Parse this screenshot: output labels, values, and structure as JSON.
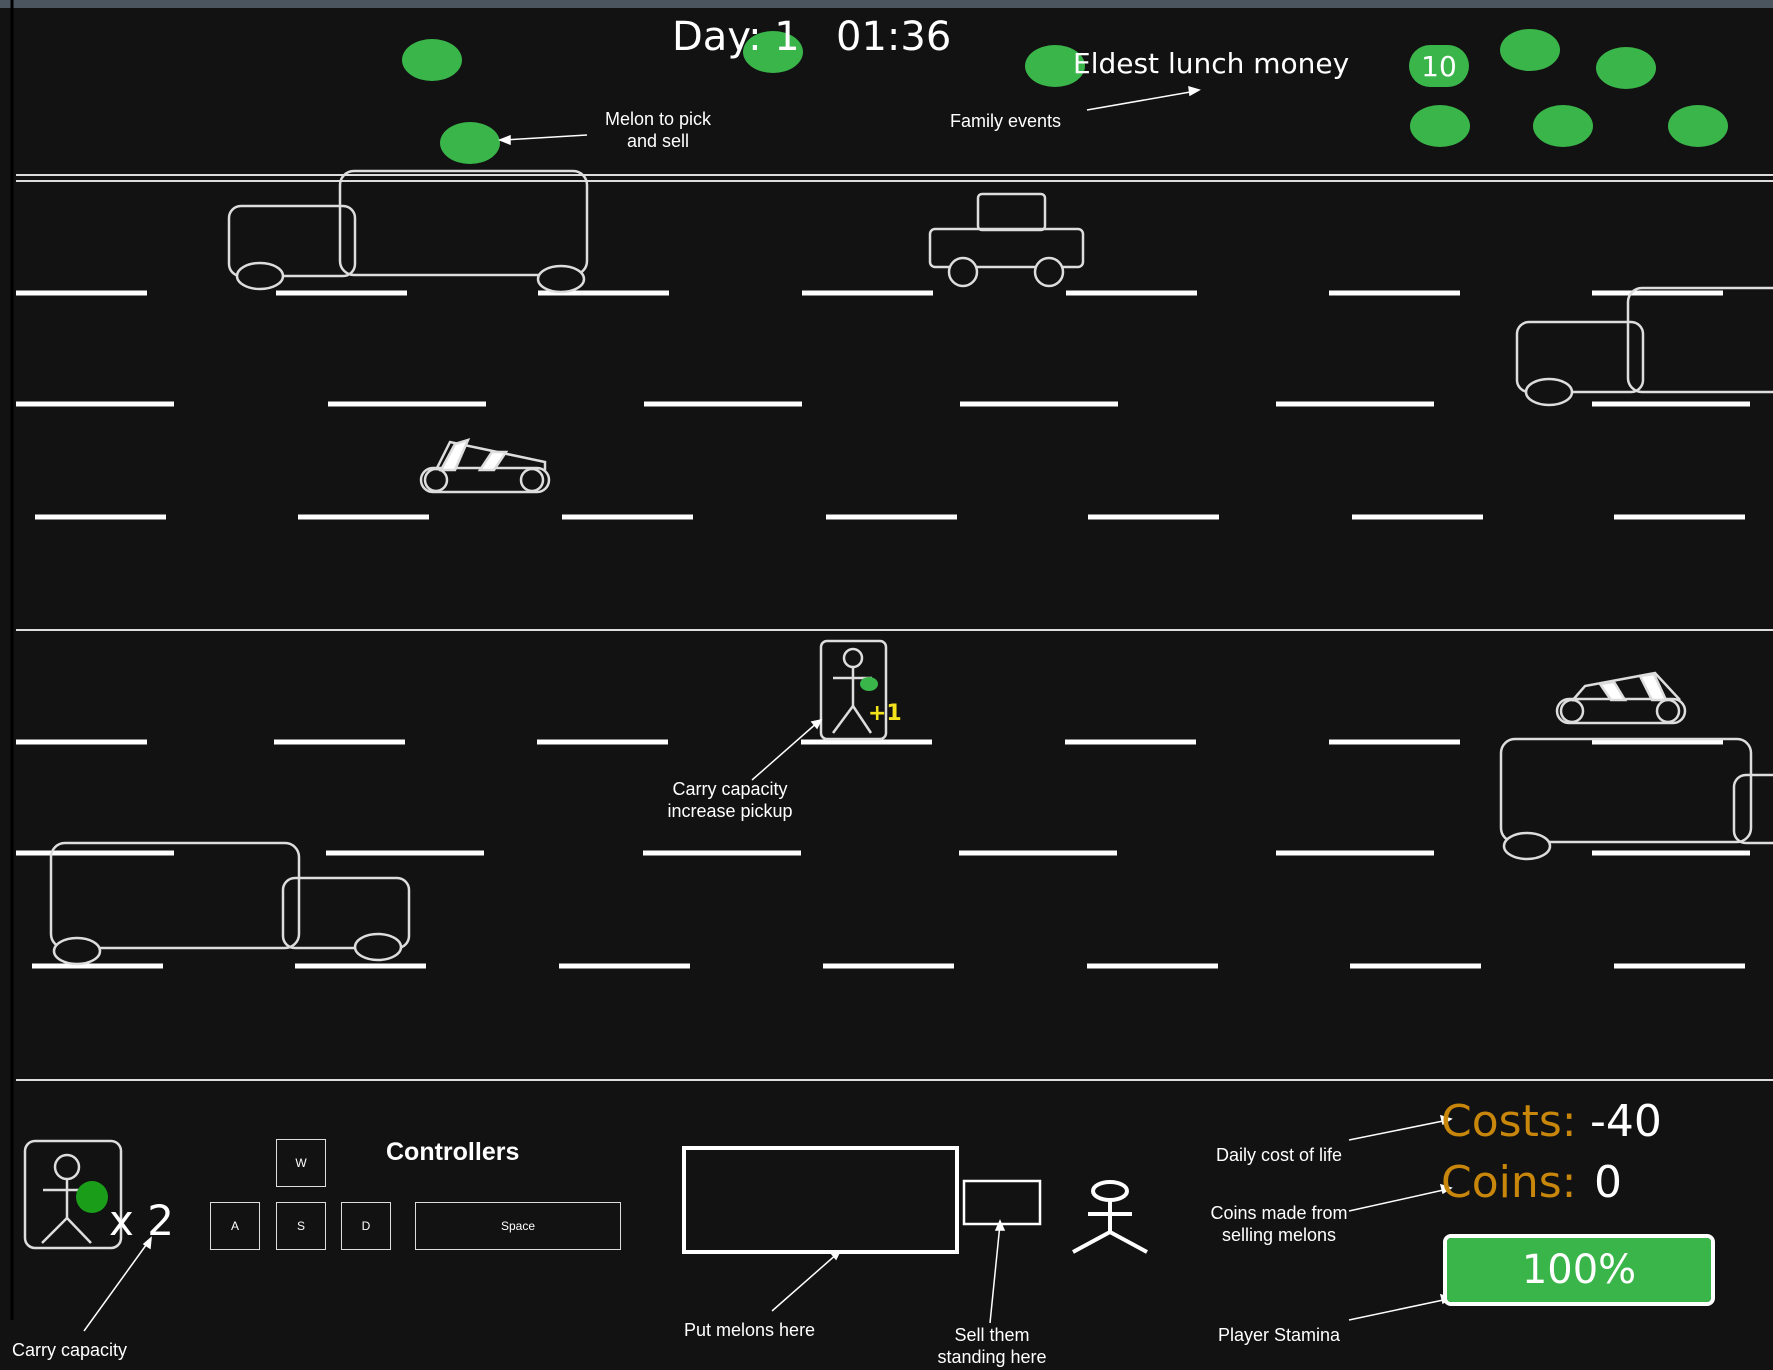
{
  "hud": {
    "day_label": "Day: 1",
    "timer": "01:36",
    "event_text": "Eldest lunch money",
    "event_badge": "10"
  },
  "annotations": {
    "melon": "Melon to pick and sell",
    "family_events": "Family events",
    "carry_pickup": "Carry capacity increase pickup",
    "carry_capacity": "Carry capacity",
    "put_melons": "Put melons here",
    "sell_standing": "Sell them standing here",
    "daily_cost": "Daily cost of life",
    "coins_made": "Coins made from selling melons",
    "player_stamina": "Player Stamina"
  },
  "pickup": {
    "bonus": "+1"
  },
  "carry": {
    "multiplier": "x 2"
  },
  "controls": {
    "title": "Controllers",
    "keys": {
      "w": "W",
      "a": "A",
      "s": "S",
      "d": "D",
      "space": "Space"
    }
  },
  "stats": {
    "costs_label": "Costs:",
    "costs_value": "-40",
    "coins_label": "Coins:",
    "coins_value": "0",
    "stamina_text": "100%",
    "stamina_fraction": 1.0
  },
  "colors": {
    "background": "#121212",
    "melon": "#3ab54a",
    "stat_label": "#c8860a",
    "pickup_text": "#f2e21b"
  },
  "icons": {
    "melon": "melon-icon",
    "truck": "truck-icon",
    "car": "car-icon",
    "skateboard": "skateboard-icon",
    "stick_figure": "stick-figure-icon"
  }
}
